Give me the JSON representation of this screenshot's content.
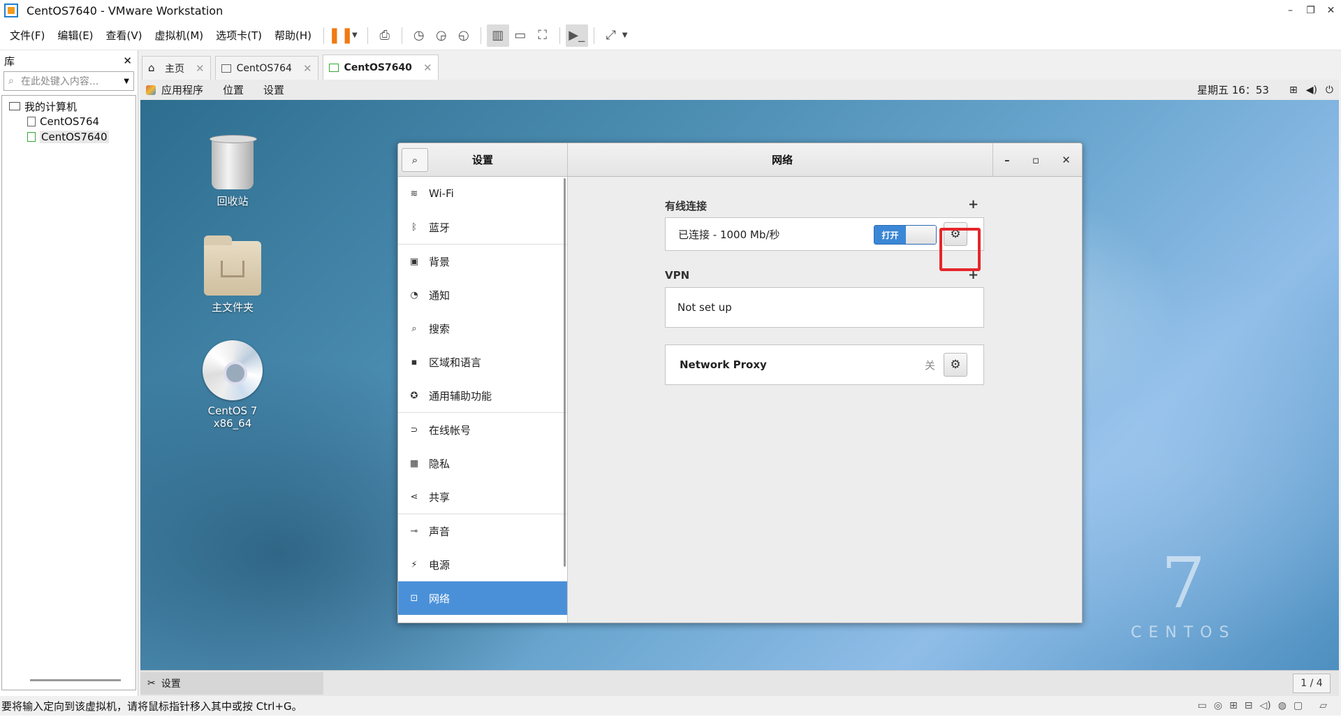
{
  "window": {
    "title": "CentOS7640 - VMware Workstation",
    "controls": [
      "–",
      "❐",
      "✕"
    ]
  },
  "menu": {
    "items": [
      "文件(F)",
      "编辑(E)",
      "查看(V)",
      "虚拟机(M)",
      "选项卡(T)",
      "帮助(H)"
    ]
  },
  "library": {
    "title": "库",
    "close": "✕",
    "search_placeholder": "在此处键入内容...",
    "root": "我的计算机",
    "vms": [
      "CentOS764",
      "CentOS7640"
    ]
  },
  "tabs": [
    {
      "label": "主页",
      "icon": "home-icon",
      "close": "✕"
    },
    {
      "label": "CentOS764",
      "icon": "vm-icon",
      "close": "✕"
    },
    {
      "label": "CentOS7640",
      "icon": "vm-running-icon",
      "close": "✕"
    }
  ],
  "gnome": {
    "menus": [
      "应用程序",
      "位置",
      "设置"
    ],
    "clock": "星期五 16：53",
    "sys_icons": [
      "network-icon",
      "volume-icon",
      "power-icon"
    ]
  },
  "desktop": {
    "icons": [
      "回收站",
      "主文件夹",
      "CentOS 7 x86_64"
    ],
    "logo_number": "7",
    "logo_word": "CENTOS"
  },
  "settings": {
    "sidebar_title": "设置",
    "page_title": "网络",
    "sidebar": [
      {
        "label": "Wi-Fi",
        "icon": "wifi-icon",
        "glyph": "≋"
      },
      {
        "label": "蓝牙",
        "icon": "bluetooth-icon",
        "glyph": "ᛒ"
      },
      {
        "label": "背景",
        "icon": "background-icon",
        "glyph": "▣"
      },
      {
        "label": "通知",
        "icon": "notification-icon",
        "glyph": "◔"
      },
      {
        "label": "搜索",
        "icon": "search-icon",
        "glyph": "⌕"
      },
      {
        "label": "区域和语言",
        "icon": "region-icon",
        "glyph": "▪"
      },
      {
        "label": "通用辅助功能",
        "icon": "accessibility-icon",
        "glyph": "✪"
      },
      {
        "label": "在线帐号",
        "icon": "online-accounts-icon",
        "glyph": "⊃"
      },
      {
        "label": "隐私",
        "icon": "privacy-icon",
        "glyph": "▦"
      },
      {
        "label": "共享",
        "icon": "share-icon",
        "glyph": "⋖"
      },
      {
        "label": "声音",
        "icon": "sound-icon",
        "glyph": "⊸"
      },
      {
        "label": "电源",
        "icon": "power-icon",
        "glyph": "⚡"
      },
      {
        "label": "网络",
        "icon": "network-icon",
        "glyph": "⊡"
      }
    ],
    "wired": {
      "title": "有线连接",
      "add": "+",
      "status": "已连接 - 1000 Mb/秒",
      "toggle_label": "打开",
      "toggle_on": true
    },
    "vpn": {
      "title": "VPN",
      "add": "+",
      "status": "Not set up"
    },
    "proxy": {
      "label": "Network Proxy",
      "state": "关"
    }
  },
  "vm_status": {
    "task": "设置",
    "pager": "1 / 4"
  },
  "status_message": "要将输入定向到该虚拟机，请将鼠标指针移入其中或按 Ctrl+G。",
  "colors": {
    "accent": "#4a90d9",
    "highlight": "#e5262a",
    "pause": "#f07a12"
  }
}
